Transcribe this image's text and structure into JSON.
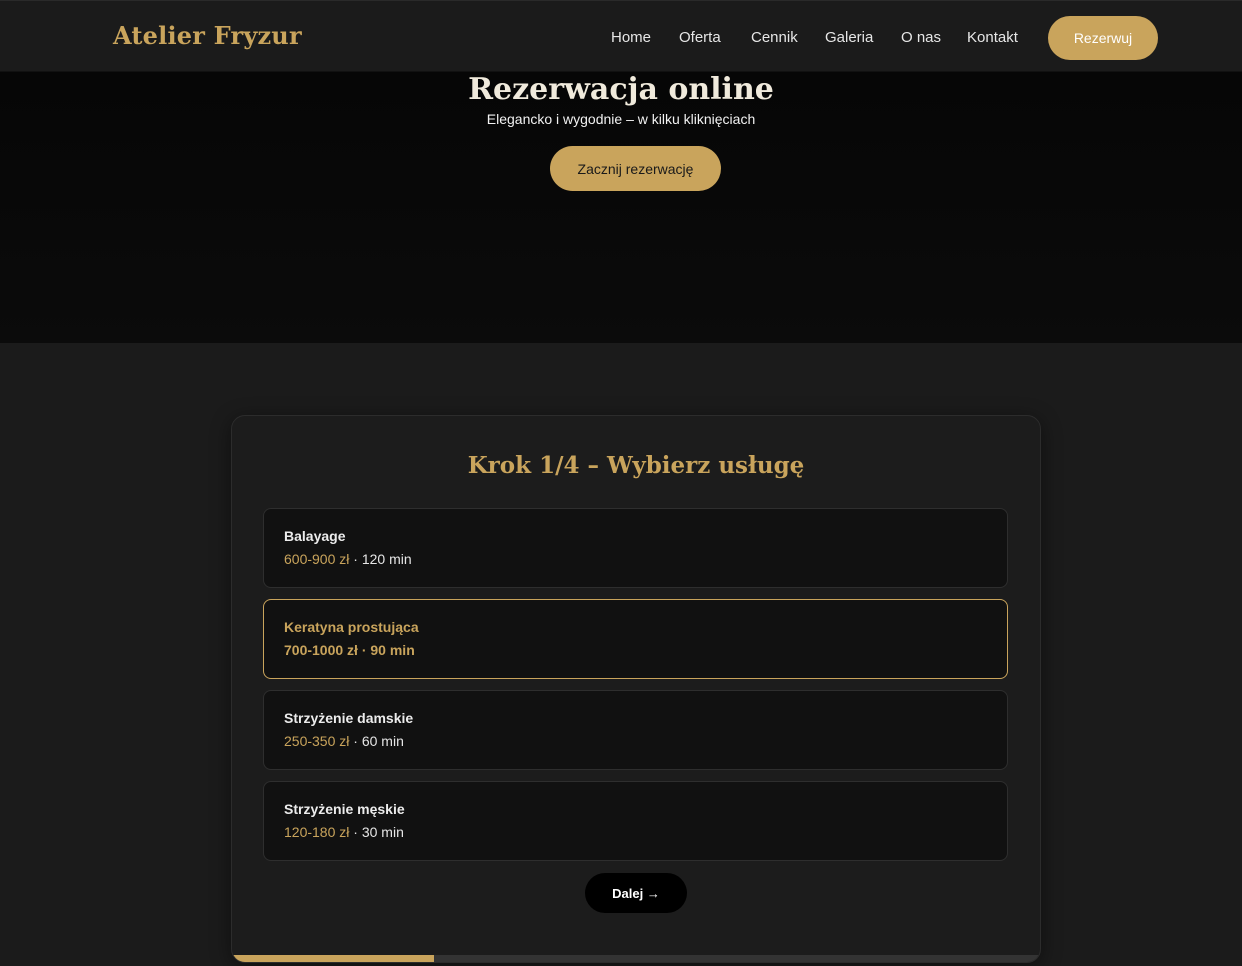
{
  "header": {
    "logo": "Atelier Fryzur",
    "nav": [
      "Home",
      "Oferta",
      "Cennik",
      "Galeria",
      "O nas",
      "Kontakt"
    ],
    "cta": "Rezerwuj"
  },
  "hero": {
    "title": "Rezerwacja online",
    "subtitle": "Elegancko i wygodnie – w kilku kliknięciach",
    "button": "Zacznij rezerwację"
  },
  "booking": {
    "step_title": "Krok 1/4 – Wybierz usługę",
    "services": [
      {
        "name": "Balayage",
        "price": "600-900 zł",
        "duration": " · 120 min",
        "selected": false
      },
      {
        "name": "Keratyna prostująca",
        "price": "700-1000 zł",
        "duration": " · 90 min",
        "selected": true
      },
      {
        "name": "Strzyżenie damskie",
        "price": "250-350 zł",
        "duration": " · 60 min",
        "selected": false
      },
      {
        "name": "Strzyżenie męskie",
        "price": "120-180 zł",
        "duration": " · 30 min",
        "selected": false
      }
    ],
    "next_label": "Dalej →",
    "progress": 0.25
  },
  "colors": {
    "accent": "#c9a45c",
    "background": "#1b1b1b",
    "hero_background": "#080808"
  }
}
